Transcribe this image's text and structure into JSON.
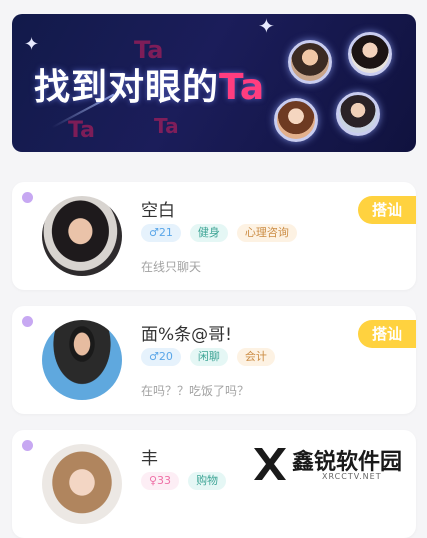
{
  "banner": {
    "headline_main": "找到对眼的",
    "headline_accent": "Ta",
    "decor_text": "Ta"
  },
  "users": [
    {
      "name": "空白",
      "age": "♂21",
      "gender": "male",
      "tags": [
        "健身",
        "心理咨询"
      ],
      "status": "在线只聊天",
      "action": "搭讪"
    },
    {
      "name": "面%条@哥!",
      "age": "♂20",
      "gender": "male",
      "tags": [
        "闲聊",
        "会计"
      ],
      "status": "在吗？？吃饭了吗？",
      "action": "搭讪"
    },
    {
      "name": "丰",
      "age": "♀33",
      "gender": "female",
      "tags": [
        "购物"
      ],
      "status": "",
      "action": ""
    }
  ],
  "watermark": {
    "brand": "鑫锐软件园",
    "domain": "XRCCTV.NET"
  }
}
